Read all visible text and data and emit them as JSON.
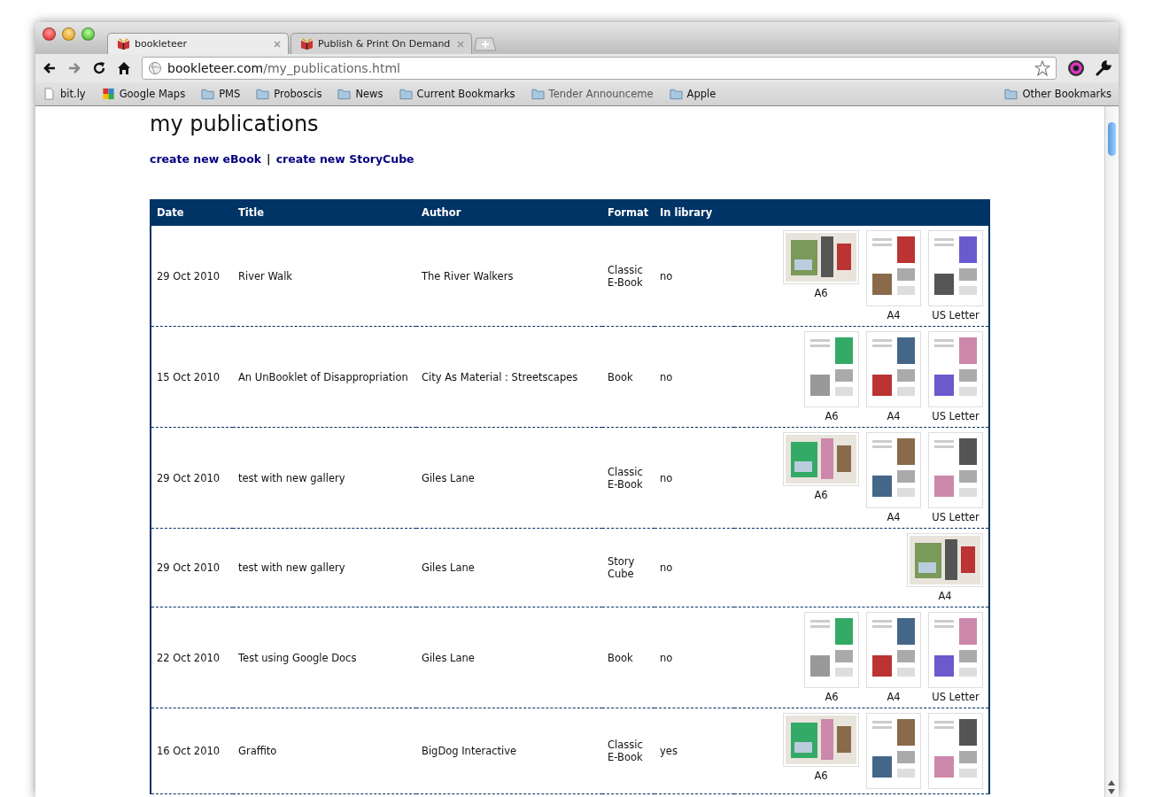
{
  "browser": {
    "tabs": [
      {
        "title": "bookleteer",
        "selected": true
      },
      {
        "title": "Publish & Print On Demand",
        "selected": false
      }
    ],
    "nav": [
      {
        "kind": "back",
        "disabled": false
      },
      {
        "kind": "forward",
        "disabled": true
      },
      {
        "kind": "reload",
        "disabled": false
      },
      {
        "kind": "home",
        "disabled": false
      }
    ],
    "address": {
      "host": "bookleteer.com",
      "path": "/my_publications.html"
    },
    "bookmarks": [
      {
        "label": "bit.ly",
        "kind": "page"
      },
      {
        "label": "Google Maps",
        "kind": "maps"
      },
      {
        "label": "PMS",
        "kind": "folder"
      },
      {
        "label": "Proboscis",
        "kind": "folder"
      },
      {
        "label": "News",
        "kind": "folder"
      },
      {
        "label": "Current Bookmarks",
        "kind": "folder"
      },
      {
        "label": "Tender Announceme",
        "kind": "folder"
      },
      {
        "label": "Apple",
        "kind": "folder"
      }
    ],
    "other_bookmarks": "Other Bookmarks"
  },
  "page": {
    "heading": "my publications",
    "links": [
      "create new eBook",
      "create new StoryCube"
    ],
    "separator": "|",
    "table": {
      "columns": [
        "Date",
        "Title",
        "Author",
        "Format",
        "In library"
      ],
      "rows": [
        {
          "date": "29 Oct 2010",
          "title": "River Walk",
          "author": "The River Walkers",
          "format": "Classic E-Book",
          "in_library": "no",
          "thumbnails": [
            {
              "kind": "landscape",
              "label": "A6"
            },
            {
              "kind": "portrait",
              "label": "A4"
            },
            {
              "kind": "portrait",
              "label": "US Letter"
            }
          ]
        },
        {
          "date": "15 Oct 2010",
          "title": "An UnBooklet of Disappropriation",
          "author": "City As Material : Streetscapes",
          "format": "Book",
          "in_library": "no",
          "thumbnails": [
            {
              "kind": "portrait",
              "label": "A6"
            },
            {
              "kind": "portrait",
              "label": "A4"
            },
            {
              "kind": "portrait",
              "label": "US Letter"
            }
          ]
        },
        {
          "date": "29 Oct 2010",
          "title": "test with new gallery",
          "author": "Giles Lane",
          "format": "Classic E-Book",
          "in_library": "no",
          "thumbnails": [
            {
              "kind": "landscape",
              "label": "A6"
            },
            {
              "kind": "portrait",
              "label": "A4"
            },
            {
              "kind": "portrait",
              "label": "US Letter"
            }
          ]
        },
        {
          "date": "29 Oct 2010",
          "title": "test with new gallery",
          "author": "Giles Lane",
          "format": "Story Cube",
          "in_library": "no",
          "thumbnails": [
            {
              "kind": "landscape",
              "label": "A4"
            }
          ]
        },
        {
          "date": "22 Oct 2010",
          "title": "Test using Google Docs",
          "author": "Giles Lane",
          "format": "Book",
          "in_library": "no",
          "thumbnails": [
            {
              "kind": "portrait",
              "label": "A6"
            },
            {
              "kind": "portrait",
              "label": "A4"
            },
            {
              "kind": "portrait",
              "label": "US Letter"
            }
          ]
        },
        {
          "date": "16 Oct 2010",
          "title": "Graffito",
          "author": "BigDog Interactive",
          "format": "Classic E-Book",
          "in_library": "yes",
          "thumbnails": [
            {
              "kind": "landscape",
              "label": "A6"
            },
            {
              "kind": "portrait"
            },
            {
              "kind": "portrait"
            }
          ]
        }
      ]
    }
  }
}
